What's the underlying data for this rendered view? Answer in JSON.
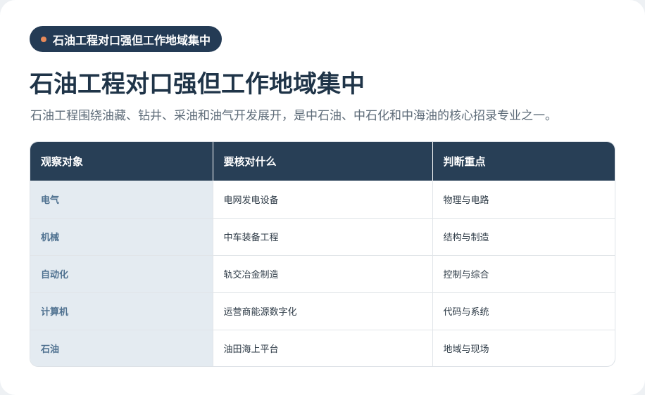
{
  "badge": {
    "label": "石油工程对口强但工作地域集中"
  },
  "heading": {
    "title": "石油工程对口强但工作地域集中",
    "subtitle": "石油工程围绕油藏、钻井、采油和油气开发展开，是中石油、中石化和中海油的核心招录专业之一。"
  },
  "table": {
    "headers": [
      "观察对象",
      "要核对什么",
      "判断重点"
    ],
    "rows": [
      [
        "电气",
        "电网发电设备",
        "物理与电路"
      ],
      [
        "机械",
        "中车装备工程",
        "结构与制造"
      ],
      [
        "自动化",
        "轨交冶金制造",
        "控制与综合"
      ],
      [
        "计算机",
        "运营商能源数字化",
        "代码与系统"
      ],
      [
        "石油",
        "油田海上平台",
        "地域与现场"
      ]
    ]
  },
  "colors": {
    "header_bg": "#283f56",
    "badge_bg": "#243b55",
    "badge_dot": "#e98b5a",
    "first_col_bg": "#e4ebf1",
    "first_col_text": "#4f7190"
  }
}
